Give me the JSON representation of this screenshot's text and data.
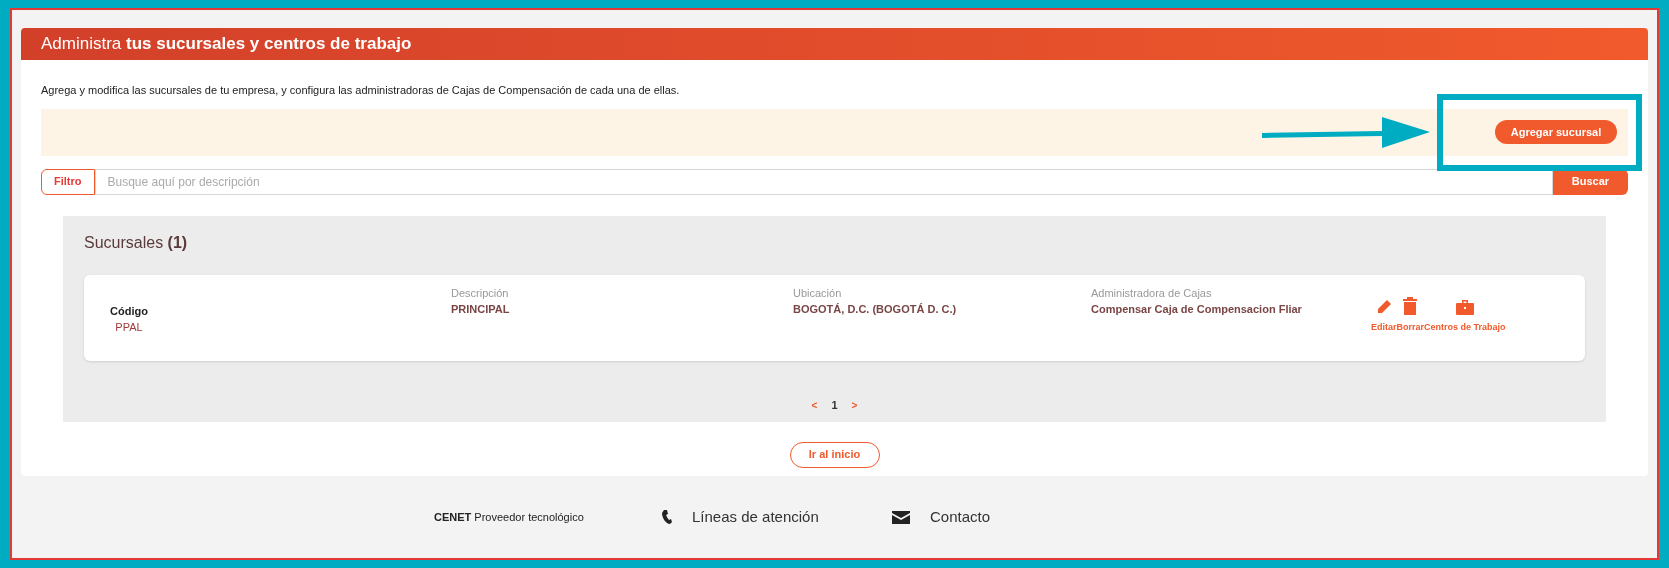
{
  "header": {
    "title": "Administra **tus sucursales y centros de trabajo**"
  },
  "intro": "Agrega y modifica las sucursales de tu empresa, y configura las administradoras de Cajas de Compensación de cada una de ellas.",
  "add_button": "Agregar sucursal",
  "filter": {
    "label": "Filtro",
    "placeholder": "Busque aquí por descripción",
    "button": "Buscar"
  },
  "list": {
    "title": "Sucursales **(1)**",
    "rows": [
      {
        "code_label": "Código",
        "code": "PPAL",
        "fields": [
          {
            "label": "Descripción",
            "value": "PRINCIPAL"
          },
          {
            "label": "Ubicación",
            "value": "BOGOTÁ, D.C. (BOGOTÁ  D. C.)"
          },
          {
            "label": "Administradora de Cajas",
            "value": "Compensar Caja de Compensacion Fliar"
          }
        ],
        "actions": [
          {
            "kind": "edit",
            "label": "Editar"
          },
          {
            "kind": "delete",
            "label": "Borrar"
          },
          {
            "kind": "work",
            "label": "Centros de Trabajo"
          }
        ]
      }
    ]
  },
  "pagination": {
    "prev": "<",
    "pages": [
      {
        "label": "1",
        "selected": true
      }
    ],
    "next": ">"
  },
  "home_button": "Ir al inicio",
  "footer": [
    {
      "kind": "brand",
      "text": "**CENET** Proveedor tecnológico"
    },
    {
      "kind": "phone",
      "text": "Líneas de atención"
    },
    {
      "kind": "mail",
      "text": "Contacto"
    }
  ]
}
